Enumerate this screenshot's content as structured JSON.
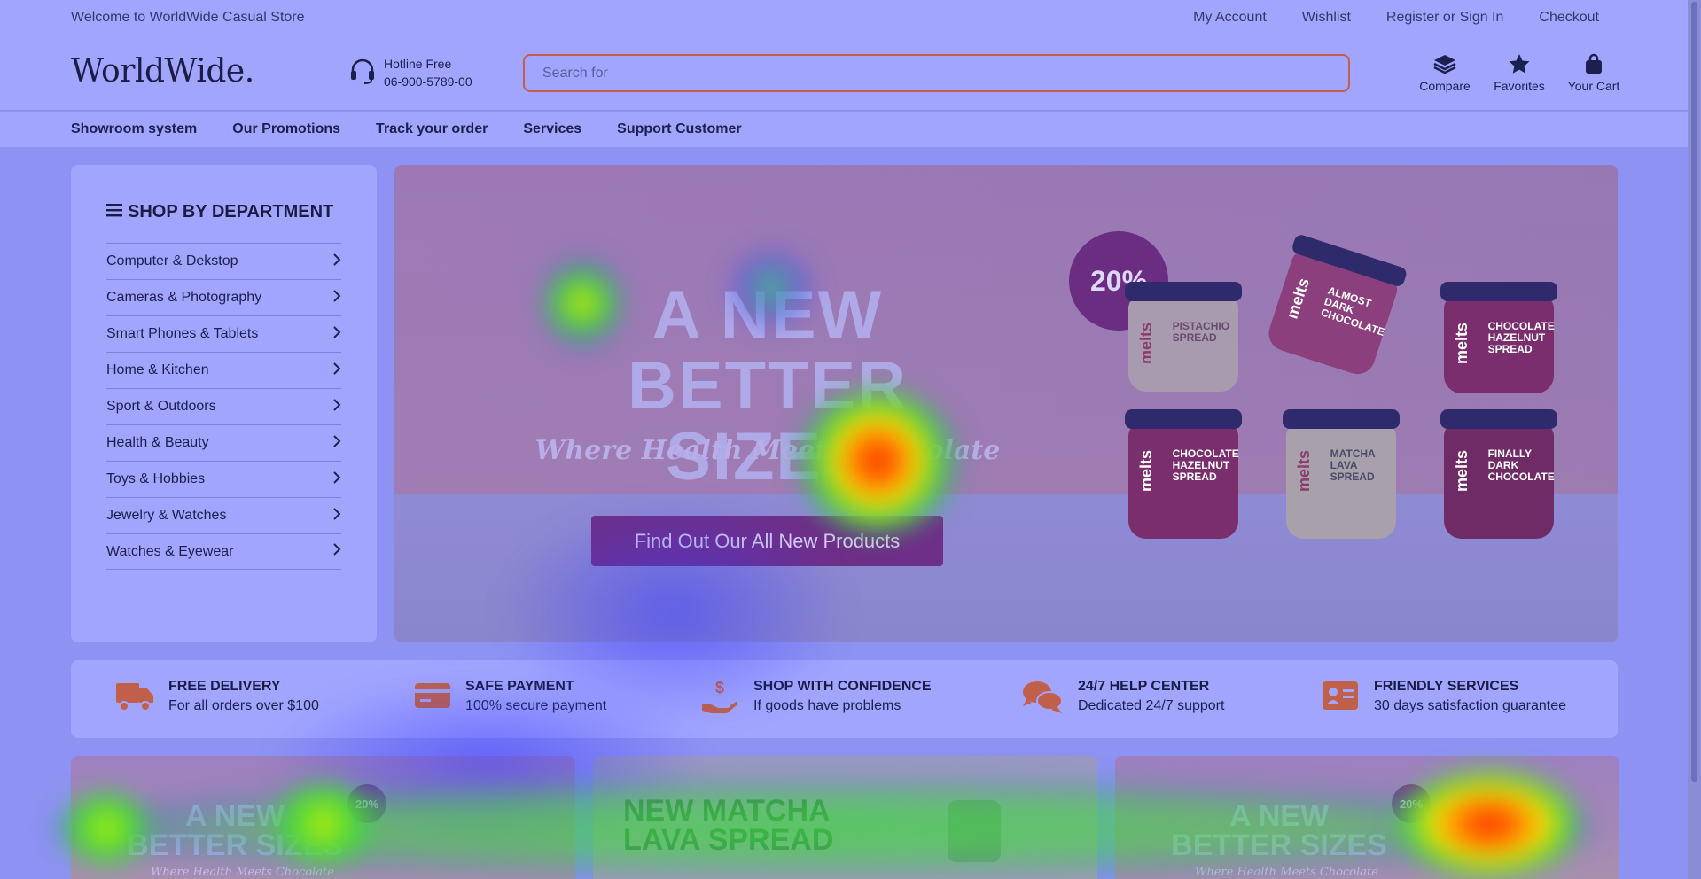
{
  "topbar": {
    "welcome": "Welcome to WorldWide Casual Store",
    "links": [
      "My Account",
      "Wishlist",
      "Register or Sign In",
      "Checkout"
    ]
  },
  "header": {
    "logo": "WorldWide.",
    "hotline_label": "Hotline Free",
    "hotline_number": "06-900-5789-00",
    "search_placeholder": "Search for",
    "icons": [
      {
        "label": "Compare",
        "icon": "layers-icon"
      },
      {
        "label": "Favorites",
        "icon": "star-icon"
      },
      {
        "label": "Your Cart",
        "icon": "bag-icon"
      }
    ]
  },
  "nav": {
    "items": [
      "Showroom system",
      "Our Promotions",
      "Track your order",
      "Services",
      "Support Customer"
    ]
  },
  "sidebar": {
    "title": "SHOP BY DEPARTMENT",
    "items": [
      "Computer & Dekstop",
      "Cameras & Photography",
      "Smart Phones & Tablets",
      "Home & Kitchen",
      "Sport & Outdoors",
      "Health & Beauty",
      "Toys & Hobbies",
      "Jewelry & Watches",
      "Watches & Eyewear"
    ]
  },
  "hero": {
    "heading_line1": "A NEW",
    "heading_line2": "BETTER SIZES",
    "tagline": "Where Health Meets Chocolate",
    "cta": "Find Out Our All New Products",
    "badge": "20%",
    "jars": [
      {
        "brand": "melts",
        "label": "PISTACHIO SPREAD"
      },
      {
        "brand": "melts",
        "label": "ALMOST DARK CHOCOLATE"
      },
      {
        "brand": "melts",
        "label": "CHOCOLATE HAZELNUT SPREAD"
      },
      {
        "brand": "melts",
        "label": "CHOCOLATE HAZELNUT SPREAD"
      },
      {
        "brand": "melts",
        "label": "MATCHA LAVA SPREAD"
      },
      {
        "brand": "melts",
        "label": "FINALLY DARK CHOCOLATE"
      }
    ]
  },
  "features": [
    {
      "title": "FREE DELIVERY",
      "desc": "For all orders over $100",
      "icon": "truck-icon"
    },
    {
      "title": "SAFE PAYMENT",
      "desc": "100% secure payment",
      "icon": "credit-card-icon"
    },
    {
      "title": "SHOP WITH CONFIDENCE",
      "desc": "If goods have problems",
      "icon": "hand-dollar-icon"
    },
    {
      "title": "24/7 HELP CENTER",
      "desc": "Dedicated 24/7 support",
      "icon": "chat-bubbles-icon"
    },
    {
      "title": "FRIENDLY SERVICES",
      "desc": "30 days satisfaction guarantee",
      "icon": "id-card-icon"
    }
  ],
  "banners": [
    {
      "line1": "A NEW",
      "line2": "BETTER SIZES",
      "sub": "Where Health Meets Chocolate",
      "badge": "20%"
    },
    {
      "line1": "NEW MATCHA",
      "line2": "LAVA SPREAD",
      "sub": "",
      "badge": ""
    },
    {
      "line1": "A NEW",
      "line2": "BETTER SIZES",
      "sub": "Where Health Meets Chocolate",
      "badge": "20%"
    }
  ],
  "colors": {
    "overlay": "#a1a5fe",
    "accent_orange": "#c0604a",
    "cta_purple": "#6e2f88"
  }
}
